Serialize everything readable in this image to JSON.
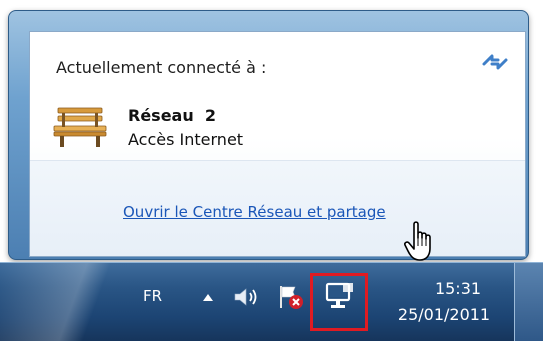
{
  "flyout": {
    "title": "Actuellement connecté à :",
    "network_name": "Réseau  2",
    "network_status": "Accès Internet",
    "center_link": "Ouvrir le Centre Réseau et partage"
  },
  "taskbar": {
    "language": "FR",
    "time": "15:31",
    "date": "25/01/2011"
  },
  "icons": {
    "refresh": "refresh-icon",
    "network_type": "bench-icon",
    "cursor": "hand-cursor-icon",
    "tray_overflow": "chevron-up-icon",
    "volume": "speaker-icon",
    "action_center": "flag-error-icon",
    "network": "network-icon"
  },
  "colors": {
    "link": "#1a56b8",
    "highlight": "#e01b22",
    "taskbar": "#1c4473"
  }
}
